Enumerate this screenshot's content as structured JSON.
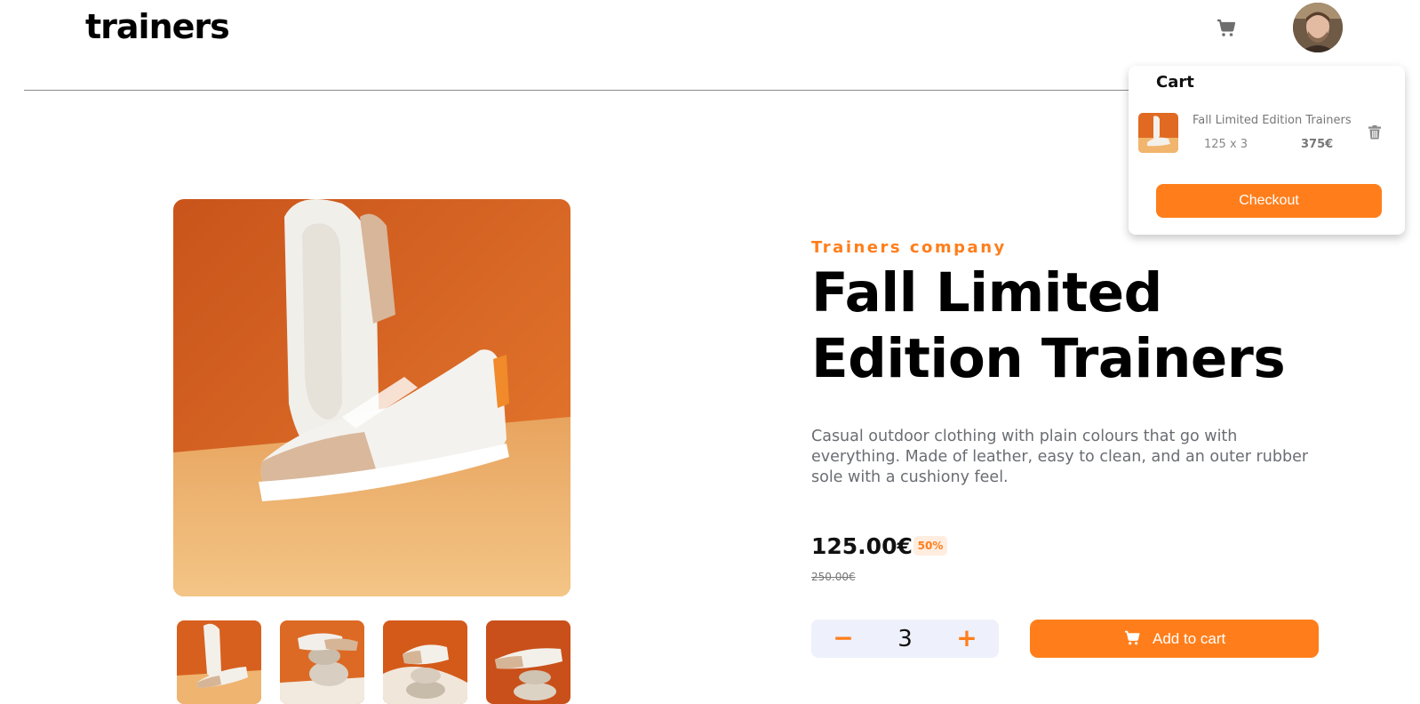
{
  "header": {
    "logo": "trainers",
    "cart_icon": "cart-icon",
    "avatar_icon": "user-avatar"
  },
  "cart": {
    "title": "Cart",
    "item": {
      "name": "Fall Limited Edition Trainers",
      "quantity_line": "125 x 3",
      "total": "375€"
    },
    "delete_icon": "trash-icon",
    "checkout_label": "Checkout"
  },
  "product": {
    "company": "Trainers company",
    "title": "Fall Limited Edition Trainers",
    "description": "Casual outdoor clothing with plain colours that go with everything. Made of leather, easy to clean, and an outer rubber sole with a cushiony feel.",
    "price": "125.00€",
    "discount": "50%",
    "original_price": "250.00€"
  },
  "quantity": {
    "minus": "−",
    "value": "3",
    "plus": "+"
  },
  "add_to_cart": {
    "label": "Add to cart",
    "icon": "cart-icon"
  },
  "colors": {
    "accent": "#ff7e1b",
    "text": "#000000",
    "muted": "#6a6d73",
    "pale_accent": "#ffede0",
    "stepper_bg": "#eef0fb"
  }
}
